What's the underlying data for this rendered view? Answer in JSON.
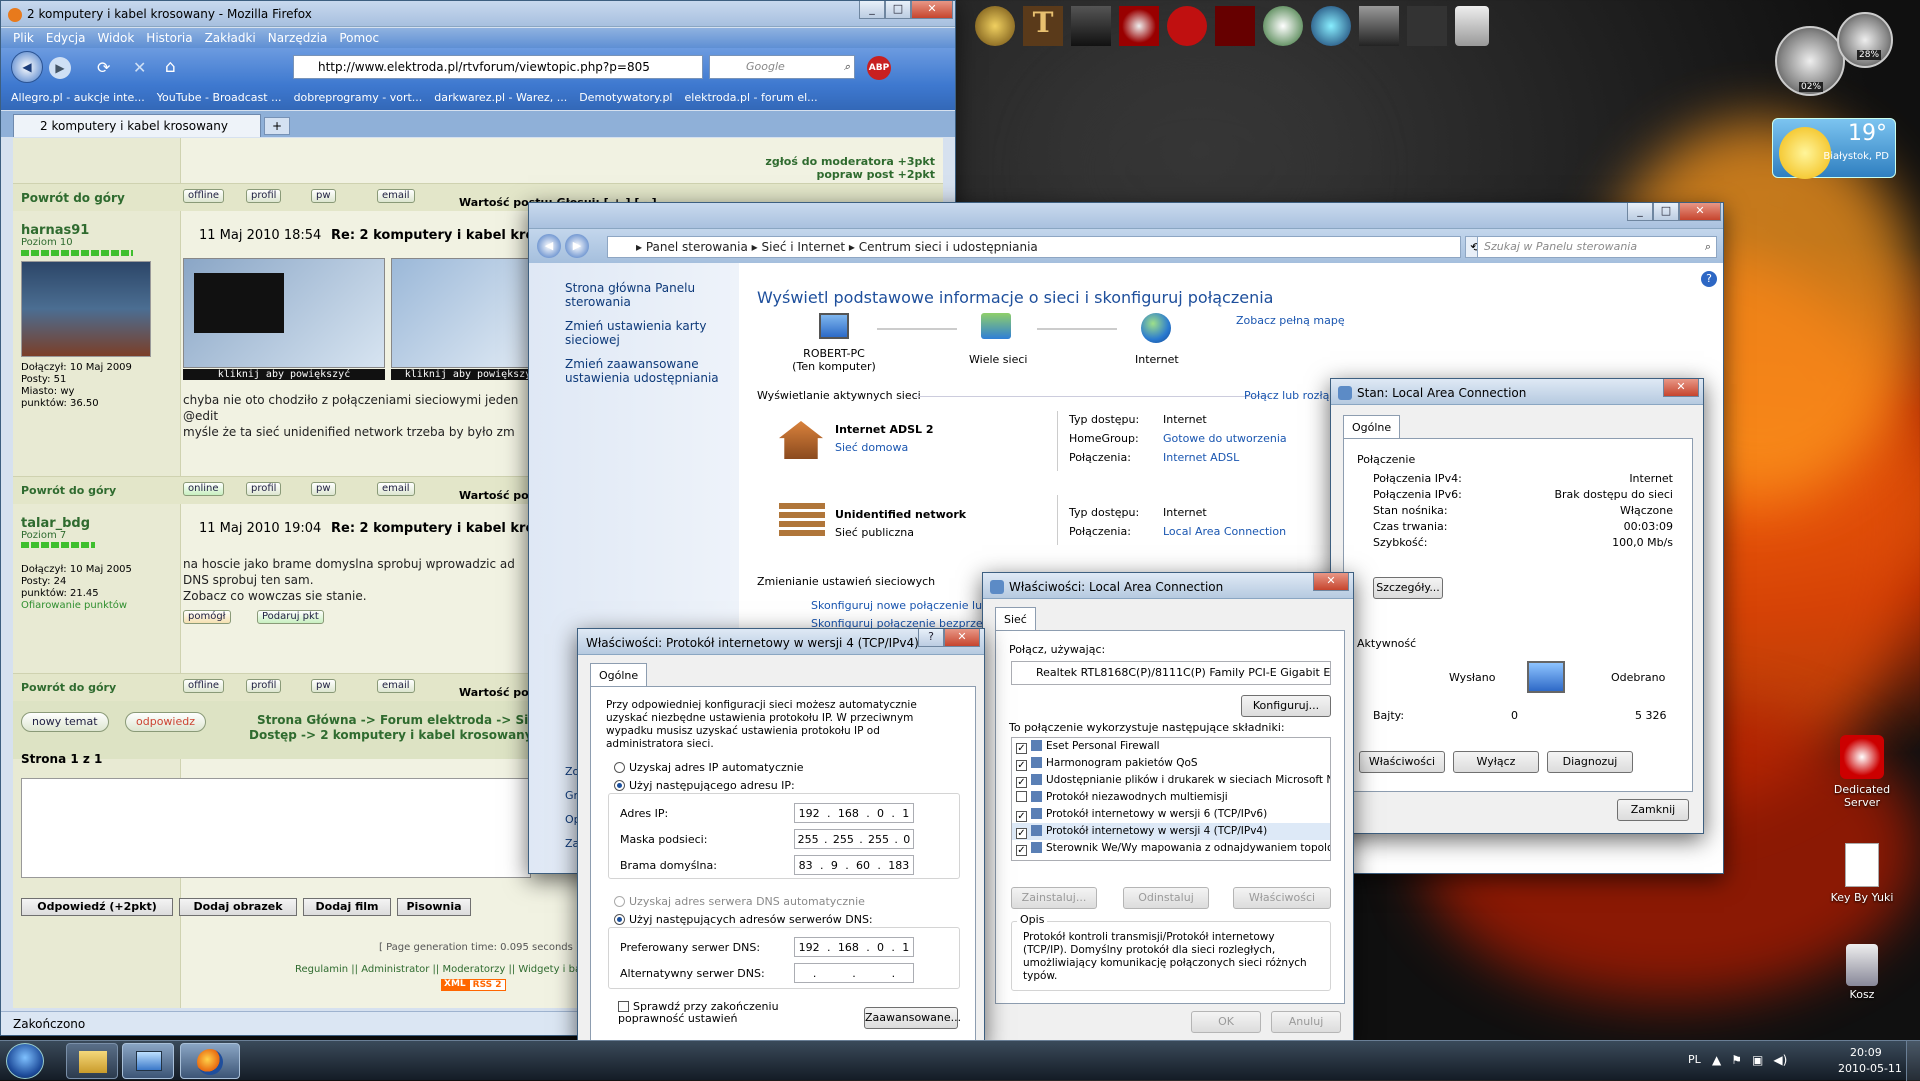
{
  "firefox": {
    "title": "2 komputery i kabel krosowany - Mozilla Firefox",
    "menu": [
      "Plik",
      "Edycja",
      "Widok",
      "Historia",
      "Zakładki",
      "Narzędzia",
      "Pomoc"
    ],
    "url": "http://www.elektroda.pl/rtvforum/viewtopic.php?p=805",
    "search_placeholder": "Google",
    "bookmarks": [
      "Allegro.pl - aukcje inte...",
      "YouTube - Broadcast ...",
      "dobreprogramy - vort...",
      "darkwarez.pl - Warez, ...",
      "Demotywatory.pl",
      "elektroda.pl - forum el..."
    ],
    "tab": "2 komputery i kabel krosowany",
    "status": "Zakończono",
    "forum": {
      "report": "zgłoś do moderatora +3pkt",
      "improve": "popraw post +2pkt",
      "back_top": "Powrót do góry",
      "btn_offline": "offline",
      "btn_online": "online",
      "btn_profil": "profil",
      "btn_pw": "pw",
      "btn_email": "email",
      "post_value": "Wartość postu: Głosuj: [ + ] [ - ]",
      "post_value_short": "Wartość postu:",
      "post1": {
        "user": "harnas91",
        "rank": "Poziom 10",
        "date": "11 Maj 2010 18:54",
        "title": "Re: 2 komputery i kabel kroso",
        "joined": "Dołączył: 10 Maj 2009",
        "posts": "Posty: 51",
        "city": "Miasto: wy",
        "points": "punktów: 36.50",
        "thumb": "kliknij aby powiększyć",
        "line1": "chyba nie oto chodziło z połączeniami sieciowymi jeden",
        "line2": "@edit",
        "line3": "myśle że ta sieć unidenified network trzeba by było zm"
      },
      "post2": {
        "user": "talar_bdg",
        "rank": "Poziom 7",
        "date": "11 Maj 2010 19:04",
        "title": "Re: 2 komputery i kabel kroso",
        "joined": "Dołączył: 10 Maj 2005",
        "posts": "Posty: 24",
        "points": "punktów: 21.45",
        "gift": "Ofiarowanie punktów",
        "line1": "na hoscie jako brame domyslna sprobuj wprowadzic ad",
        "line2": "DNS sprobuj ten sam.",
        "line3": "Zobacz co wowczas sie stanie.",
        "help": "pomógł",
        "give": "Podaruj pkt"
      },
      "new_topic": "nowy temat",
      "reply": "odpowiedz",
      "breadcrumb1": "Strona Główna -> Forum elektroda -> Sie",
      "breadcrumb2": "Dostęp -> 2 komputery i kabel krosowany",
      "page": "Strona 1 z 1",
      "b_reply": "Odpowiedź (+2pkt)",
      "b_img": "Dodaj obrazek",
      "b_film": "Dodaj film",
      "b_spell": "Pisownia",
      "gen": "[ Page generation time: 0.095 seconds ]",
      "footer": "Regulamin || Administrator || Moderatorzy || Widgety i ban",
      "xml": "XML",
      "rss": "RSS 2"
    }
  },
  "gadgets": {
    "cpu": "02%",
    "mem": "28%",
    "temp": "19°",
    "city": "Białystok, PD"
  },
  "desktop": {
    "dedicated": "Dedicated Server",
    "key": "Key By Yuki",
    "trash": "Kosz"
  },
  "taskbar": {
    "lang": "PL",
    "time": "20:09",
    "date": "2010-05-11"
  },
  "cp": {
    "crumb": [
      "Panel sterowania",
      "Sieć i Internet",
      "Centrum sieci i udostępniania"
    ],
    "search": "Szukaj w Panelu sterowania",
    "side": [
      "Strona główna Panelu sterowania",
      "Zmień ustawienia karty sieciowej",
      "Zmień zaawansowane ustawienia udostępniania"
    ],
    "side_hidden": [
      "Zo",
      "Gr",
      "Op",
      "Za"
    ],
    "heading": "Wyświetl podstawowe informacje o sieci i skonfiguruj połączenia",
    "fullmap": "Zobacz pełną mapę",
    "map": [
      {
        "label": "ROBERT-PC\n(Ten komputer)"
      },
      {
        "label": "Wiele sieci"
      },
      {
        "label": "Internet"
      }
    ],
    "active": "Wyświetlanie aktywnych sieci",
    "connect": "Połącz lub rozłą",
    "net1": {
      "name": "Internet ADSL  2",
      "type": "Sieć domowa",
      "access_l": "Typ dostępu:",
      "access": "Internet",
      "hg_l": "HomeGroup:",
      "hg": "Gotowe do utworzenia",
      "conn_l": "Połączenia:",
      "conn": "Internet ADSL"
    },
    "net2": {
      "name": "Unidentified network",
      "type": "Sieć publiczna",
      "access_l": "Typ dostępu:",
      "access": "Internet",
      "conn_l": "Połączenia:",
      "conn": "Local Area Connection"
    },
    "change": "Zmienianie ustawień sieciowych",
    "newconn": "Skonfiguruj nowe połączenie lub",
    "newconn2": "Skonfiguruj połączenie bezprze"
  },
  "status": {
    "title": "Stan: Local Area Connection",
    "tab": "Ogólne",
    "conn": "Połączenie",
    "rows": [
      {
        "k": "Połączenia IPv4:",
        "v": "Internet"
      },
      {
        "k": "Połączenia IPv6:",
        "v": "Brak dostępu do sieci"
      },
      {
        "k": "Stan nośnika:",
        "v": "Włączone"
      },
      {
        "k": "Czas trwania:",
        "v": "00:03:09"
      },
      {
        "k": "Szybkość:",
        "v": "100,0 Mb/s"
      }
    ],
    "details": "Szczegóły...",
    "activity": "Aktywność",
    "sent": "Wysłano",
    "recv": "Odebrano",
    "bytes": "Bajty:",
    "sent_v": "0",
    "recv_v": "5 326",
    "props": "Właściwości",
    "disable": "Wyłącz",
    "diag": "Diagnozuj",
    "close": "Zamknij"
  },
  "lan": {
    "title": "Właściwości: Local Area Connection",
    "tab": "Sieć",
    "using": "Połącz, używając:",
    "adapter": "Realtek RTL8168C(P)/8111C(P) Family PCI-E Gigabit Ethe",
    "configure": "Konfiguruj...",
    "uses": "To połączenie wykorzystuje następujące składniki:",
    "items": [
      {
        "t": "Eset Personal Firewall",
        "c": true
      },
      {
        "t": "Harmonogram pakietów QoS",
        "c": true
      },
      {
        "t": "Udostępnianie plików i drukarek w sieciach Microsoft N",
        "c": true
      },
      {
        "t": "Protokół niezawodnych multiemisji",
        "c": false
      },
      {
        "t": "Protokół internetowy w wersji 6 (TCP/IPv6)",
        "c": true
      },
      {
        "t": "Protokół internetowy w wersji 4 (TCP/IPv4)",
        "c": true
      },
      {
        "t": "Sterownik We/Wy mapowania z odnajdywaniem topolo",
        "c": true
      }
    ],
    "install": "Zainstaluj...",
    "uninstall": "Odinstaluj",
    "props": "Właściwości",
    "desc_l": "Opis",
    "desc": "Protokół kontroli transmisji/Protokół internetowy (TCP/IP). Domyślny protokół dla sieci rozległych, umożliwiający komunikację połączonych sieci różnych typów.",
    "ok": "OK",
    "cancel": "Anuluj"
  },
  "ipv4": {
    "title": "Właściwości: Protokół internetowy w wersji 4 (TCP/IPv4)",
    "tab": "Ogólne",
    "intro": "Przy odpowiedniej konfiguracji sieci możesz automatycznie uzyskać niezbędne ustawienia protokołu IP. W przeciwnym wypadku musisz uzyskać ustawienia protokołu IP od administratora sieci.",
    "auto_ip": "Uzyskaj adres IP automatycznie",
    "manual_ip": "Użyj następującego adresu IP:",
    "ip_l": "Adres IP:",
    "ip": [
      "192",
      "168",
      "0",
      "1"
    ],
    "mask_l": "Maska podsieci:",
    "mask": [
      "255",
      "255",
      "255",
      "0"
    ],
    "gw_l": "Brama domyślna:",
    "gw": [
      "83",
      "9",
      "60",
      "183"
    ],
    "auto_dns": "Uzyskaj adres serwera DNS automatycznie",
    "manual_dns": "Użyj następujących adresów serwerów DNS:",
    "dns1_l": "Preferowany serwer DNS:",
    "dns1": [
      "192",
      "168",
      "0",
      "1"
    ],
    "dns2_l": "Alternatywny serwer DNS:",
    "validate": "Sprawdź przy zakończeniu poprawność ustawień",
    "advanced": "Zaawansowane..."
  }
}
